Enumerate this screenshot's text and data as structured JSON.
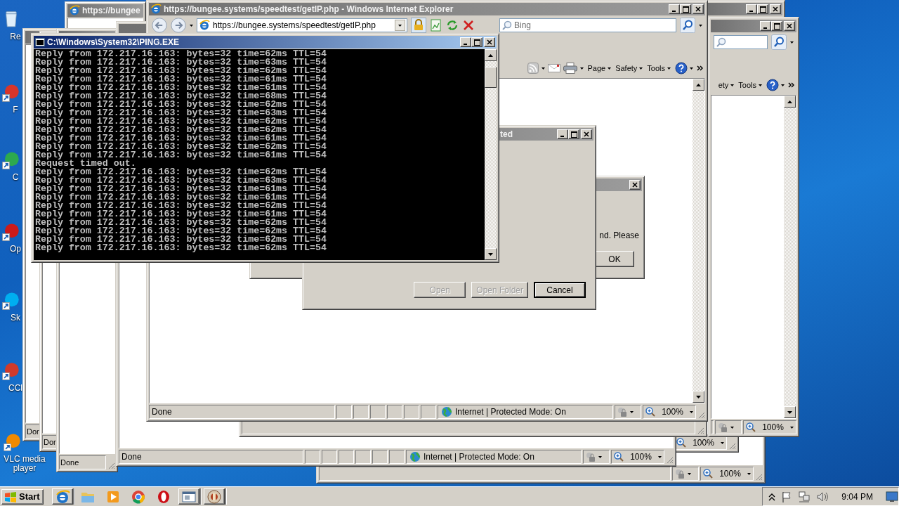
{
  "desktop_icons": [
    {
      "label": "Re"
    },
    {
      "label": "F"
    },
    {
      "label": "C"
    },
    {
      "label": "Op"
    },
    {
      "label": "Sk"
    },
    {
      "label": "CCl"
    },
    {
      "label": "VLC media player"
    }
  ],
  "windows": [
    {
      "kind": "plain",
      "active": false
    },
    {
      "kind": "browser",
      "zoom": "100%"
    },
    {
      "kind": "browser",
      "zoom": "100%"
    },
    {
      "kind": "browser",
      "active": false,
      "toolbar": true,
      "commands": [
        "ety",
        "Tools"
      ],
      "zoom": "100%"
    },
    {
      "kind": "browser",
      "status": "Dor"
    },
    {
      "kind": "browser",
      "status": "Dor"
    },
    {
      "kind": "browser",
      "active": false,
      "title": "https://bungee"
    },
    {
      "kind": "browser",
      "status": "Done"
    },
    {
      "kind": "browser",
      "status": "Done",
      "zone": "Internet | Protected Mode: On",
      "zoom": "100%"
    },
    {
      "kind": "browser"
    },
    {
      "kind": "browser",
      "active": false,
      "title": "https://bungee.systems/speedtest/getIP.php - Windows Internet Explorer",
      "toolbar": true,
      "address": "https://bungee.systems/speedtest/getIP.php",
      "search_placeholder": "Bing",
      "commands": [
        "Page",
        "Safety",
        "Tools"
      ],
      "status": "Done",
      "zone": "Internet | Protected Mode: On",
      "zoom": "100%"
    },
    {
      "kind": "dialog",
      "active": false,
      "minimizable": false,
      "text": "nd. Please",
      "buttons": [
        {
          "label": "OK",
          "disabled": false,
          "default": false
        }
      ]
    },
    {
      "kind": "dialog",
      "active": false,
      "minimizable": true,
      "title": "ted",
      "buttons": [
        {
          "label": "Open",
          "disabled": true,
          "default": false
        },
        {
          "label": "Open Folder",
          "disabled": true,
          "default": false
        },
        {
          "label": "Cancel",
          "disabled": false,
          "default": true
        }
      ]
    },
    {
      "kind": "console",
      "active": true,
      "title": "C:\\Windows\\System32\\PING.EXE",
      "lines": [
        "Reply from 172.217.16.163: bytes=32 time=62ms TTL=54",
        "Reply from 172.217.16.163: bytes=32 time=63ms TTL=54",
        "Reply from 172.217.16.163: bytes=32 time=62ms TTL=54",
        "Reply from 172.217.16.163: bytes=32 time=61ms TTL=54",
        "Reply from 172.217.16.163: bytes=32 time=61ms TTL=54",
        "Reply from 172.217.16.163: bytes=32 time=68ms TTL=54",
        "Reply from 172.217.16.163: bytes=32 time=62ms TTL=54",
        "Reply from 172.217.16.163: bytes=32 time=63ms TTL=54",
        "Reply from 172.217.16.163: bytes=32 time=62ms TTL=54",
        "Reply from 172.217.16.163: bytes=32 time=62ms TTL=54",
        "Reply from 172.217.16.163: bytes=32 time=61ms TTL=54",
        "Reply from 172.217.16.163: bytes=32 time=62ms TTL=54",
        "Reply from 172.217.16.163: bytes=32 time=61ms TTL=54",
        "Request timed out.",
        "Reply from 172.217.16.163: bytes=32 time=62ms TTL=54",
        "Reply from 172.217.16.163: bytes=32 time=63ms TTL=54",
        "Reply from 172.217.16.163: bytes=32 time=61ms TTL=54",
        "Reply from 172.217.16.163: bytes=32 time=61ms TTL=54",
        "Reply from 172.217.16.163: bytes=32 time=62ms TTL=54",
        "Reply from 172.217.16.163: bytes=32 time=61ms TTL=54",
        "Reply from 172.217.16.163: bytes=32 time=62ms TTL=54",
        "Reply from 172.217.16.163: bytes=32 time=62ms TTL=54",
        "Reply from 172.217.16.163: bytes=32 time=62ms TTL=54",
        "Reply from 172.217.16.163: bytes=32 time=62ms TTL=54"
      ]
    }
  ],
  "taskbar": {
    "start": "Start",
    "apps": [
      {
        "running": true
      },
      {
        "running": false
      },
      {
        "running": false
      },
      {
        "running": false
      },
      {
        "running": false
      },
      {
        "running": true
      },
      {
        "running": true
      }
    ],
    "clock": "9:04 PM"
  }
}
